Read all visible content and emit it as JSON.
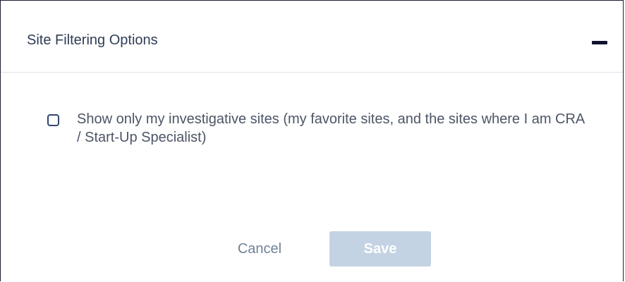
{
  "panel": {
    "title": "Site Filtering Options",
    "collapse_icon": "minus-icon"
  },
  "option": {
    "checked": false,
    "label": "Show only my investigative sites (my favorite sites, and the sites where I am CRA / Start-Up Specialist)"
  },
  "footer": {
    "cancel_label": "Cancel",
    "save_label": "Save",
    "save_enabled": false
  },
  "colors": {
    "border": "#1d2033",
    "title": "#2f3d57",
    "text": "#4c5566",
    "cancel": "#6f8298",
    "save_disabled_bg": "#c3d3e3"
  }
}
